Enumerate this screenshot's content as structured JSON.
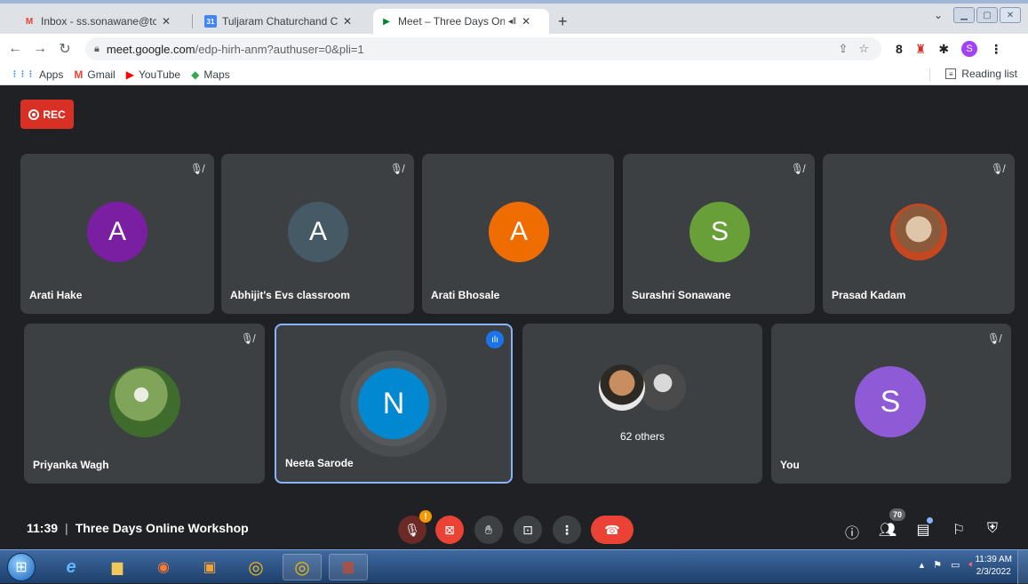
{
  "browser": {
    "tabs": [
      {
        "title": "Inbox - ss.sonawane@tccollege.c",
        "fav": "M",
        "favcolor": "#ea4335"
      },
      {
        "title": "Tuljaram Chaturchand College of",
        "fav": "31",
        "favcolor": "#4285f4"
      },
      {
        "title": "Meet – Three Days Online W",
        "fav": "▶",
        "favcolor": "#00832d"
      }
    ],
    "address": {
      "host": "meet.google.com",
      "path": "/edp-hirh-anm?authuser=0&pli=1"
    },
    "profile_initial": "S",
    "bookmarks": [
      {
        "label": "Apps",
        "icon": "⋮⋮⋮",
        "color": "#4285f4"
      },
      {
        "label": "Gmail",
        "icon": "M",
        "color": "#ea4335"
      },
      {
        "label": "YouTube",
        "icon": "▶",
        "color": "#ff0000"
      },
      {
        "label": "Maps",
        "icon": "◆",
        "color": "#34a853"
      }
    ],
    "reading_list": "Reading list"
  },
  "meet": {
    "rec_label": "REC",
    "tiles_row1": [
      {
        "name": "Arati Hake",
        "initial": "A",
        "color": "#7b1fa2",
        "muted": true
      },
      {
        "name": "Abhijit's Evs classroom",
        "initial": "A",
        "color": "#455a64",
        "muted": true
      },
      {
        "name": "Arati Bhosale",
        "initial": "A",
        "color": "#ef6c00",
        "muted": false
      },
      {
        "name": "Surashri Sonawane",
        "initial": "S",
        "color": "#689f38",
        "muted": true
      },
      {
        "name": "Prasad Kadam",
        "initial": "",
        "color": "#8d6e63",
        "muted": true
      }
    ],
    "tiles_row2": [
      {
        "name": "Priyanka Wagh",
        "initial": "",
        "color": "#558b2f",
        "muted": true
      },
      {
        "name": "Neeta Sarode",
        "initial": "N",
        "color": "#0288d1",
        "muted": false
      },
      {
        "name": "",
        "initial": "",
        "color": "#3c4043",
        "muted": false
      },
      {
        "name": "You",
        "initial": "S",
        "color": "#8e5ad6",
        "muted": true
      }
    ],
    "others_label": "62 others",
    "time": "11:39",
    "meeting_title": "Three Days Online Workshop",
    "participants_count": "70"
  },
  "taskbar": {
    "time": "11:39 AM",
    "date": "2/3/2022"
  }
}
